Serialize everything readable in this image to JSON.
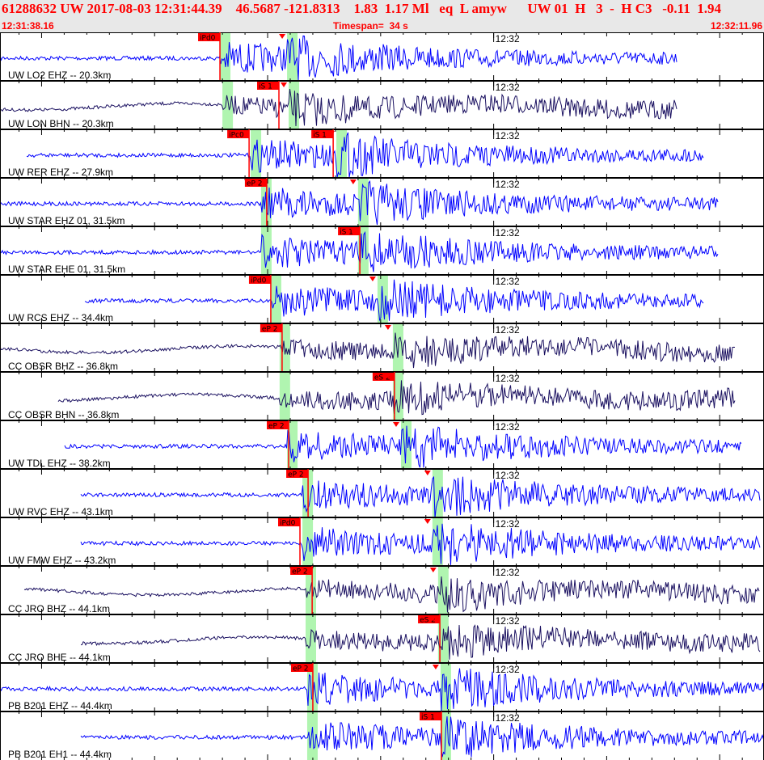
{
  "header": {
    "line1": "61288632 UW 2017-08-03 12:31:44.39    46.5687 -121.8313    1.83  1.17 Ml   eq  L amyw      UW 01  H   3  -  H C3   -0.11  1.94",
    "start_time": "12:31:38.16",
    "timespan": "Timespan=  34 s",
    "end_time": "12:32:11.96"
  },
  "axis": {
    "minute_label": "12:32",
    "start_seconds": 38.16,
    "end_seconds": 71.96
  },
  "colors": {
    "pick": "#ff0000",
    "predicted_window": "#b0f5b0",
    "trace_vertical": "#0000ff",
    "trace_broadband": "#1a1060",
    "header_bg": "#e8e8e8"
  },
  "panels": [
    {
      "label": "UW LO2 EHZ -- 20.3km",
      "color": "#0000ff",
      "pick": {
        "label": "iPd0",
        "time": 47.89
      },
      "windows": [
        47.89,
        50.86
      ]
    },
    {
      "label": "UW LON BHN -- 20.3km",
      "color": "#1a1060",
      "pick": {
        "label": "iS 1",
        "time": 50.5
      },
      "windows": [
        48.0,
        50.93
      ]
    },
    {
      "label": "UW RER EHZ -- 27.9km",
      "color": "#0000ff",
      "pick": {
        "label": "iPc0",
        "time": 49.18
      },
      "pick2": {
        "label": "iS 1",
        "time": 52.9
      },
      "windows": [
        49.25,
        53.04
      ]
    },
    {
      "label": "UW STAR EHZ 01, 31.5km",
      "color": "#0000ff",
      "pick": {
        "label": "eP 2",
        "time": 49.96
      },
      "windows": [
        49.71,
        54.0
      ]
    },
    {
      "label": "UW STAR EHE 01, 31.5km",
      "color": "#0000ff",
      "pick": {
        "label": "iS 1",
        "time": 54.08
      },
      "windows": [
        49.71,
        54.0
      ]
    },
    {
      "label": "UW RCS EHZ -- 34.4km",
      "color": "#0000ff",
      "pick": {
        "label": "iPd0",
        "time": 50.14
      },
      "windows": [
        50.14,
        54.86
      ]
    },
    {
      "label": "CC OBSR BHZ -- 36.8km",
      "color": "#1a1060",
      "pick": {
        "label": "eP 2",
        "time": 50.64
      },
      "windows": [
        50.53,
        55.54
      ]
    },
    {
      "label": "CC OBSR BHN -- 36.8km",
      "color": "#1a1060",
      "pick": {
        "label": "eS 2",
        "time": 55.61
      },
      "windows": [
        50.53,
        55.54
      ]
    },
    {
      "label": "UW TDL EHZ -- 38.2km",
      "color": "#0000ff",
      "pick": {
        "label": "eP 2",
        "time": 50.93
      },
      "windows": [
        50.86,
        55.9
      ]
    },
    {
      "label": "UW RVC EHZ -- 43.1km",
      "color": "#0000ff",
      "pick": {
        "label": "eP 2",
        "time": 51.79
      },
      "windows": [
        51.54,
        57.29
      ]
    },
    {
      "label": "UW FMW EHZ -- 43.2km",
      "color": "#0000ff",
      "pick": {
        "label": "iPd0",
        "time": 51.43
      },
      "windows": [
        51.54,
        57.29
      ]
    },
    {
      "label": "CC JRO BHZ -- 44.1km",
      "color": "#1a1060",
      "pick": {
        "label": "eP 2",
        "time": 51.97
      },
      "windows": [
        51.68,
        57.54
      ]
    },
    {
      "label": "CC JRO BHE -- 44.1km",
      "color": "#1a1060",
      "pick": {
        "label": "eS 2",
        "time": 57.62
      },
      "windows": [
        51.68,
        57.54
      ]
    },
    {
      "label": "PB B201 EHZ -- 44.4km",
      "color": "#0000ff",
      "pick": {
        "label": "eP 2",
        "time": 52.0
      },
      "windows": [
        51.75,
        57.65
      ]
    },
    {
      "label": "PB B201 EH1 -- 44.4km",
      "color": "#0000ff",
      "pick": {
        "label": "iS 1",
        "time": 57.69
      },
      "windows": [
        51.75,
        57.65
      ]
    }
  ]
}
